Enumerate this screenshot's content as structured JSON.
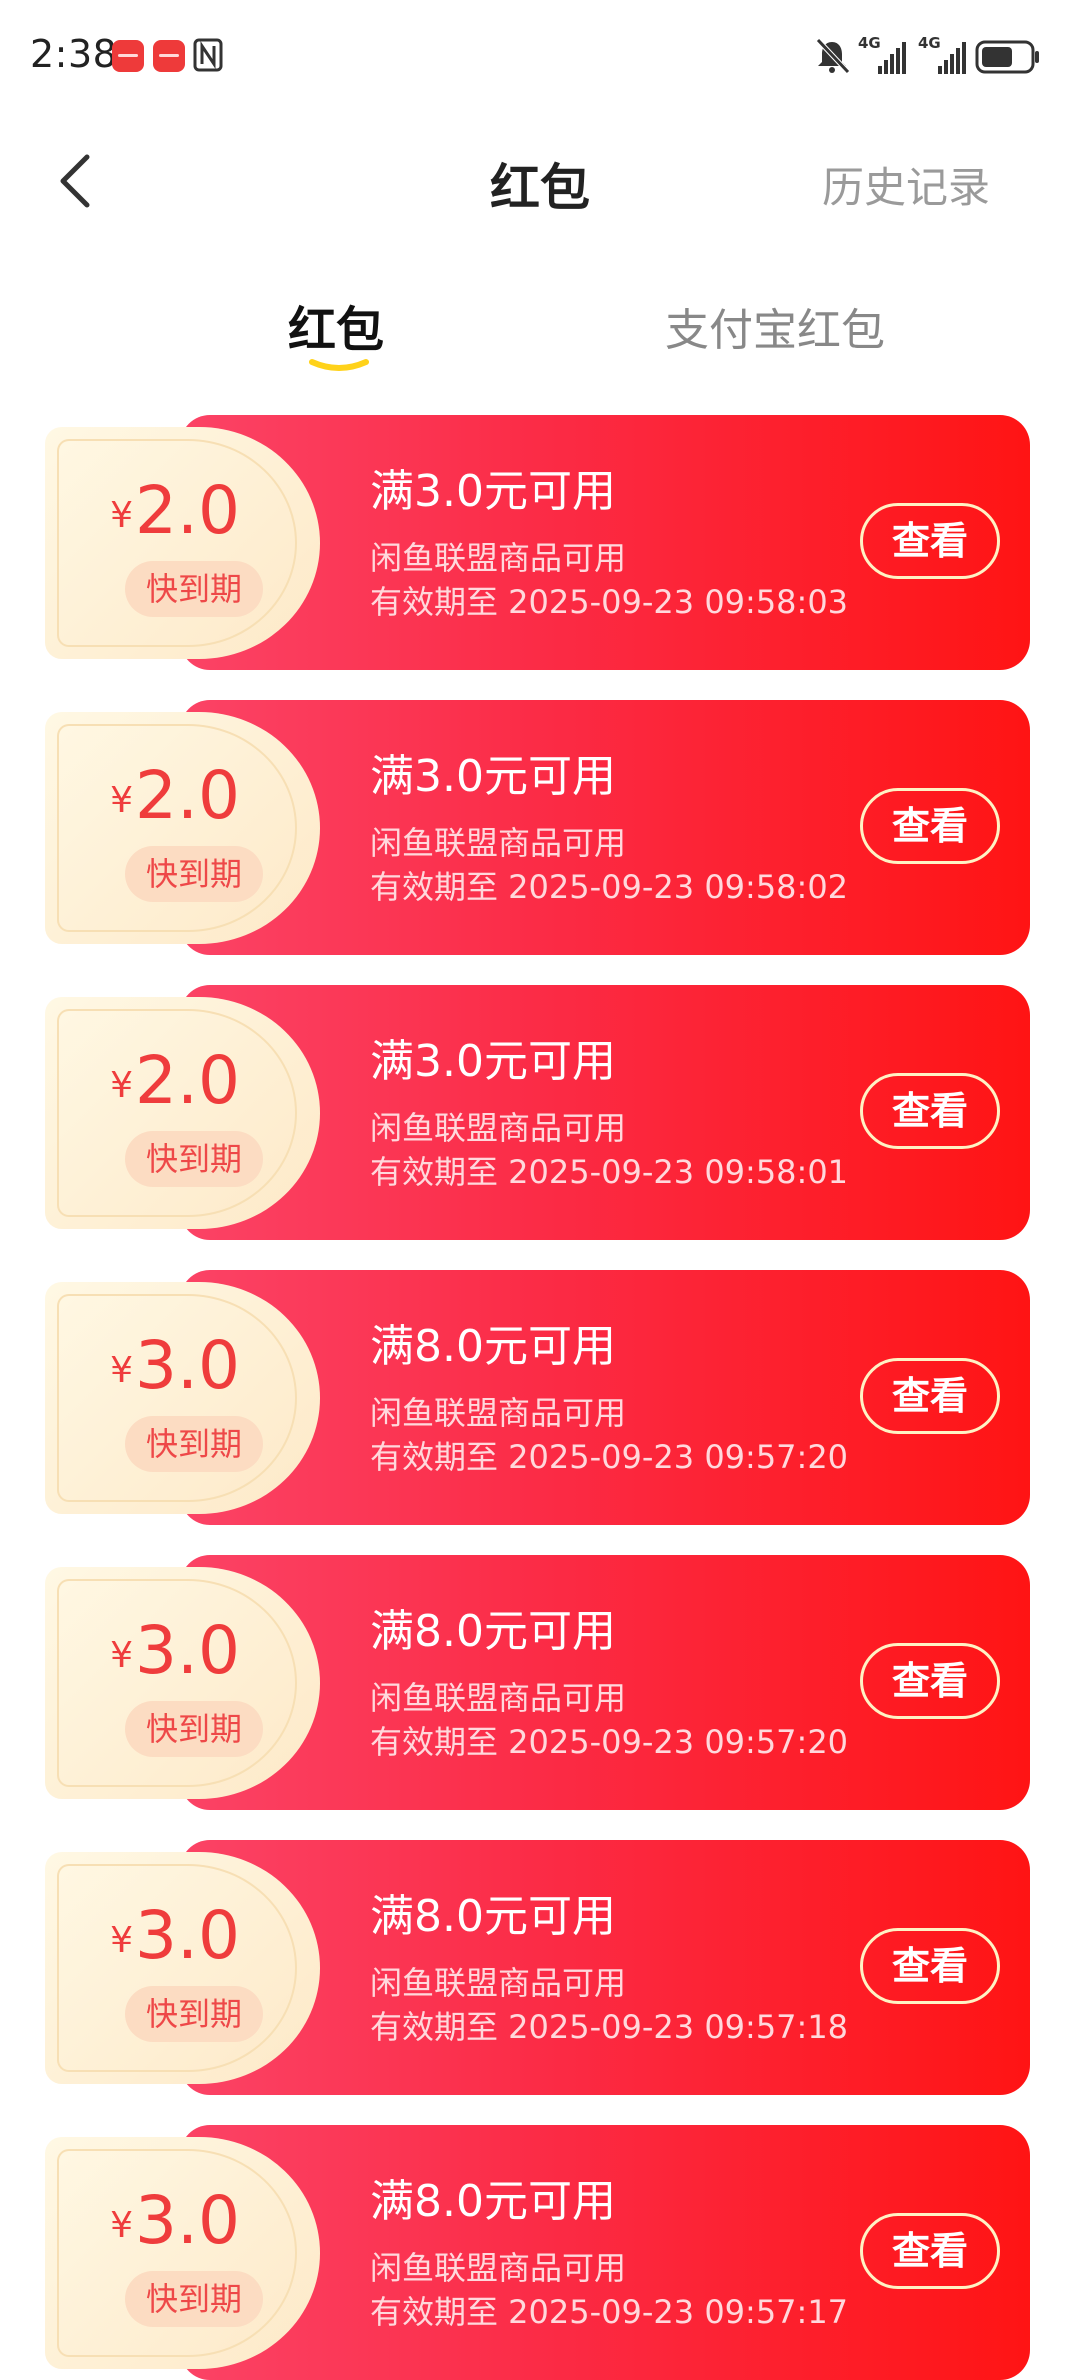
{
  "status_bar": {
    "time": "2:38",
    "network_1": "4G",
    "network_2": "4G"
  },
  "header": {
    "title": "红包",
    "history": "历史记录"
  },
  "tabs": [
    {
      "label": "红包",
      "active": true
    },
    {
      "label": "支付宝红包",
      "active": false
    }
  ],
  "colors": {
    "card_red_start": "#fb4366",
    "card_red_end": "#ff1414",
    "amount_red": "#ef3c3c",
    "tab_underline": "#ffd21a"
  },
  "coupons": [
    {
      "currency": "¥",
      "amount": "2.0",
      "badge": "快到期",
      "condition": "满3.0元可用",
      "scope": "闲鱼联盟商品可用",
      "validity": "有效期至 2025-09-23 09:58:03",
      "button": "查看"
    },
    {
      "currency": "¥",
      "amount": "2.0",
      "badge": "快到期",
      "condition": "满3.0元可用",
      "scope": "闲鱼联盟商品可用",
      "validity": "有效期至 2025-09-23 09:58:02",
      "button": "查看"
    },
    {
      "currency": "¥",
      "amount": "2.0",
      "badge": "快到期",
      "condition": "满3.0元可用",
      "scope": "闲鱼联盟商品可用",
      "validity": "有效期至 2025-09-23 09:58:01",
      "button": "查看"
    },
    {
      "currency": "¥",
      "amount": "3.0",
      "badge": "快到期",
      "condition": "满8.0元可用",
      "scope": "闲鱼联盟商品可用",
      "validity": "有效期至 2025-09-23 09:57:20",
      "button": "查看"
    },
    {
      "currency": "¥",
      "amount": "3.0",
      "badge": "快到期",
      "condition": "满8.0元可用",
      "scope": "闲鱼联盟商品可用",
      "validity": "有效期至 2025-09-23 09:57:20",
      "button": "查看"
    },
    {
      "currency": "¥",
      "amount": "3.0",
      "badge": "快到期",
      "condition": "满8.0元可用",
      "scope": "闲鱼联盟商品可用",
      "validity": "有效期至 2025-09-23 09:57:18",
      "button": "查看"
    },
    {
      "currency": "¥",
      "amount": "3.0",
      "badge": "快到期",
      "condition": "满8.0元可用",
      "scope": "闲鱼联盟商品可用",
      "validity": "有效期至 2025-09-23 09:57:17",
      "button": "查看"
    }
  ]
}
